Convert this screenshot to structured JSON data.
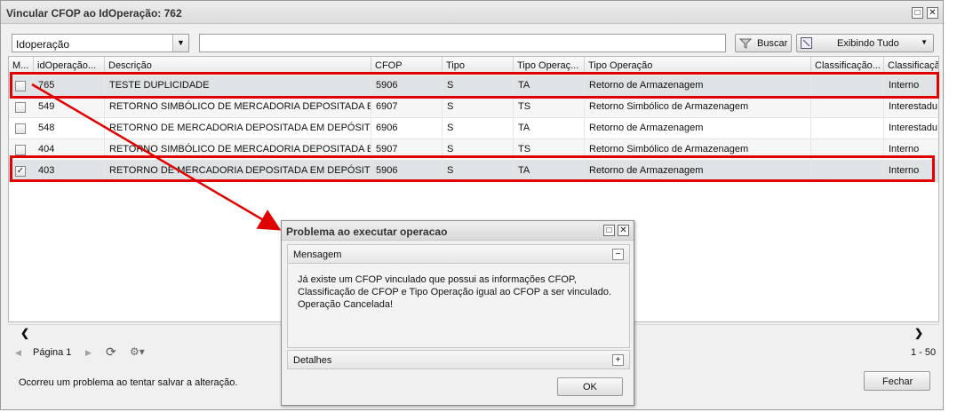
{
  "window": {
    "title": "Vincular CFOP ao IdOperação: 762",
    "restore_glyph": "□",
    "close_glyph": "✕"
  },
  "toolbar": {
    "field_select_value": "Idoperação",
    "search_value": "",
    "search_button_label": "Buscar",
    "filter_button_label": "Exibindo Tudo"
  },
  "grid": {
    "columns": [
      "M...",
      "idOperação...",
      "Descrição",
      "CFOP",
      "Tipo",
      "Tipo Operaç...",
      "Tipo Operação",
      "Classificação...",
      "Classificaçã"
    ],
    "rows": [
      {
        "checked": false,
        "id": "765",
        "descricao": "TESTE DUPLICIDADE",
        "cfop": "5906",
        "tipo": "S",
        "tipo_op_code": "TA",
        "tipo_operacao": "Retorno de Armazenagem",
        "classificacao": "",
        "classificacao2": "Interno"
      },
      {
        "checked": false,
        "id": "549",
        "descricao": "RETORNO SIMBÓLICO DE MERCADORIA DEPOSITADA E...",
        "cfop": "6907",
        "tipo": "S",
        "tipo_op_code": "TS",
        "tipo_operacao": "Retorno Simbólico de Armazenagem",
        "classificacao": "",
        "classificacao2": "Interestadu"
      },
      {
        "checked": false,
        "id": "548",
        "descricao": "RETORNO DE MERCADORIA DEPOSITADA EM DEPÓSITO...",
        "cfop": "6906",
        "tipo": "S",
        "tipo_op_code": "TA",
        "tipo_operacao": "Retorno de Armazenagem",
        "classificacao": "",
        "classificacao2": "Interestadu"
      },
      {
        "checked": false,
        "id": "404",
        "descricao": "RETORNO SIMBÓLICO DE MERCADORIA DEPOSITADA E...",
        "cfop": "5907",
        "tipo": "S",
        "tipo_op_code": "TS",
        "tipo_operacao": "Retorno Simbólico de Armazenagem",
        "classificacao": "",
        "classificacao2": "Interno"
      },
      {
        "checked": true,
        "id": "403",
        "descricao": "RETORNO DE MERCADORIA DEPOSITADA EM DEPÓSITO...",
        "cfop": "5906",
        "tipo": "S",
        "tipo_op_code": "TA",
        "tipo_operacao": "Retorno de Armazenagem",
        "classificacao": "",
        "classificacao2": "Interno"
      }
    ],
    "check_glyph": "✓"
  },
  "scroll": {
    "left_glyph": "❮",
    "right_glyph": "❯"
  },
  "pager": {
    "prev_glyph": "◀",
    "page_label": "Página 1",
    "next_glyph": "▶",
    "refresh_glyph": "⟳",
    "settings_glyph": "⚙▾",
    "range_text": "1 - 50"
  },
  "footer": {
    "status_message": "Ocorreu um problema ao tentar salvar a alteração.",
    "close_button_label": "Fechar"
  },
  "dialog": {
    "title": "Problema ao executar operacao",
    "restore_glyph": "□",
    "close_glyph": "✕",
    "message_header": "Mensagem",
    "message_collapse_glyph": "−",
    "message_lines": [
      "Já existe um CFOP vinculado que possui as informações CFOP,",
      "Classificação de CFOP e Tipo Operação igual ao CFOP a ser vinculado.",
      "Operação Cancelada!"
    ],
    "details_header": "Detalhes",
    "details_expand_glyph": "+",
    "ok_label": "OK"
  },
  "colors": {
    "annotation": "#e00000",
    "highlight_row": "#dfe3e6"
  }
}
